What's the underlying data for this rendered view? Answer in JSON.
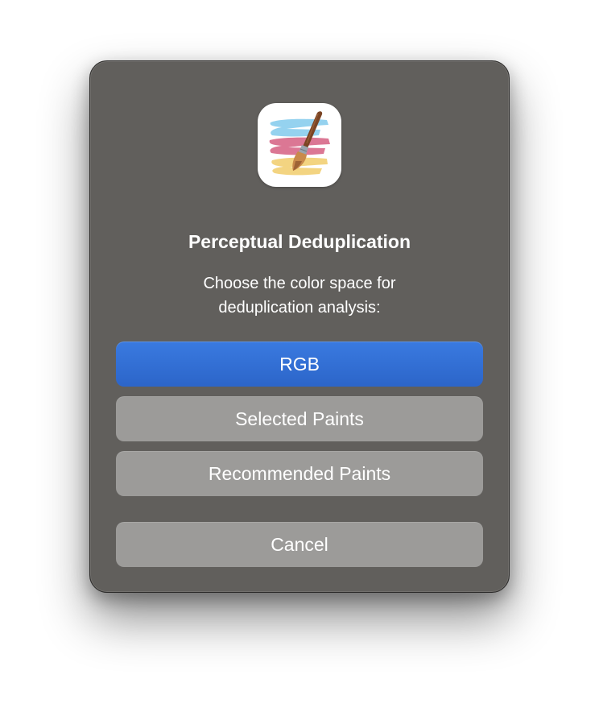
{
  "dialog": {
    "icon": "paintbrush-app-icon",
    "title": "Perceptual Deduplication",
    "message_line1": "Choose the color space for",
    "message_line2": "deduplication analysis:",
    "buttons": {
      "rgb": "RGB",
      "selected_paints": "Selected Paints",
      "recommended_paints": "Recommended Paints",
      "cancel": "Cancel"
    }
  },
  "colors": {
    "dialog_background": "#615f5c",
    "primary_button": "#3270d6",
    "secondary_button": "#9c9b99",
    "stroke_blue": "#8fd0ee",
    "stroke_pink": "#d9708e",
    "stroke_yellow": "#f2d27a",
    "brush_handle": "#7a4424"
  }
}
